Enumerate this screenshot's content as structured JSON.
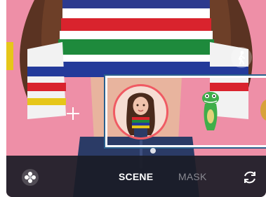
{
  "camera": {
    "modes": [
      {
        "label": "SCENE",
        "active": true
      },
      {
        "label": "MASK",
        "active": false
      }
    ]
  },
  "icons": {
    "sticker": "flower-sticker-icon",
    "switch_camera": "switch-camera-icon",
    "walk_mode": "walking-person-icon",
    "add": "plus-icon"
  },
  "colors": {
    "background": "#ee8fa7",
    "selection_ring": "#f05a63",
    "bottom_bar": "#1a1c26",
    "frame_highlight": "#ffffff"
  }
}
